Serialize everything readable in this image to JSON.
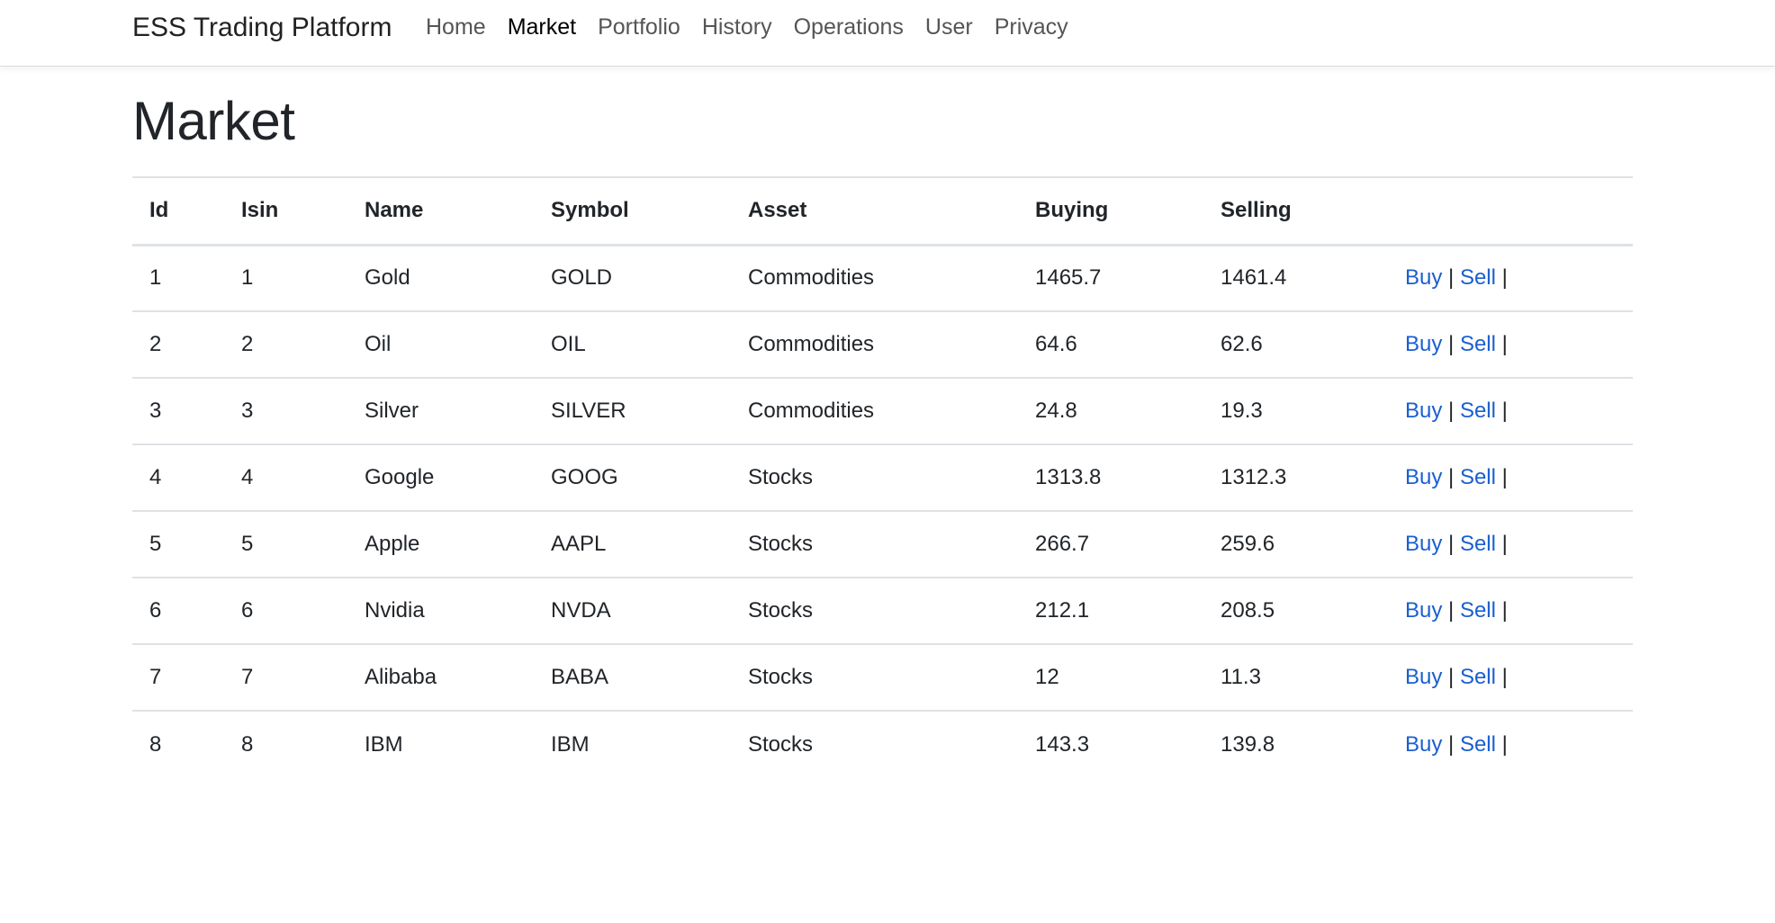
{
  "navbar": {
    "brand": "ESS Trading Platform",
    "links": [
      {
        "label": "Home",
        "active": false
      },
      {
        "label": "Market",
        "active": true
      },
      {
        "label": "Portfolio",
        "active": false
      },
      {
        "label": "History",
        "active": false
      },
      {
        "label": "Operations",
        "active": false
      },
      {
        "label": "User",
        "active": false
      },
      {
        "label": "Privacy",
        "active": false
      }
    ]
  },
  "page": {
    "title": "Market"
  },
  "table": {
    "headers": {
      "id": "Id",
      "isin": "Isin",
      "name": "Name",
      "symbol": "Symbol",
      "asset": "Asset",
      "buying": "Buying",
      "selling": "Selling"
    },
    "actions": {
      "buy": "Buy",
      "sell": "Sell",
      "separator": "|"
    },
    "rows": [
      {
        "id": "1",
        "isin": "1",
        "name": "Gold",
        "symbol": "GOLD",
        "asset": "Commodities",
        "buying": "1465.7",
        "selling": "1461.4"
      },
      {
        "id": "2",
        "isin": "2",
        "name": "Oil",
        "symbol": "OIL",
        "asset": "Commodities",
        "buying": "64.6",
        "selling": "62.6"
      },
      {
        "id": "3",
        "isin": "3",
        "name": "Silver",
        "symbol": "SILVER",
        "asset": "Commodities",
        "buying": "24.8",
        "selling": "19.3"
      },
      {
        "id": "4",
        "isin": "4",
        "name": "Google",
        "symbol": "GOOG",
        "asset": "Stocks",
        "buying": "1313.8",
        "selling": "1312.3"
      },
      {
        "id": "5",
        "isin": "5",
        "name": "Apple",
        "symbol": "AAPL",
        "asset": "Stocks",
        "buying": "266.7",
        "selling": "259.6"
      },
      {
        "id": "6",
        "isin": "6",
        "name": "Nvidia",
        "symbol": "NVDA",
        "asset": "Stocks",
        "buying": "212.1",
        "selling": "208.5"
      },
      {
        "id": "7",
        "isin": "7",
        "name": "Alibaba",
        "symbol": "BABA",
        "asset": "Stocks",
        "buying": "12",
        "selling": "11.3"
      },
      {
        "id": "8",
        "isin": "8",
        "name": "IBM",
        "symbol": "IBM",
        "asset": "Stocks",
        "buying": "143.3",
        "selling": "139.8"
      }
    ]
  },
  "colors": {
    "link": "#1a5fd0",
    "text": "#212529",
    "border": "#dee2e6"
  }
}
